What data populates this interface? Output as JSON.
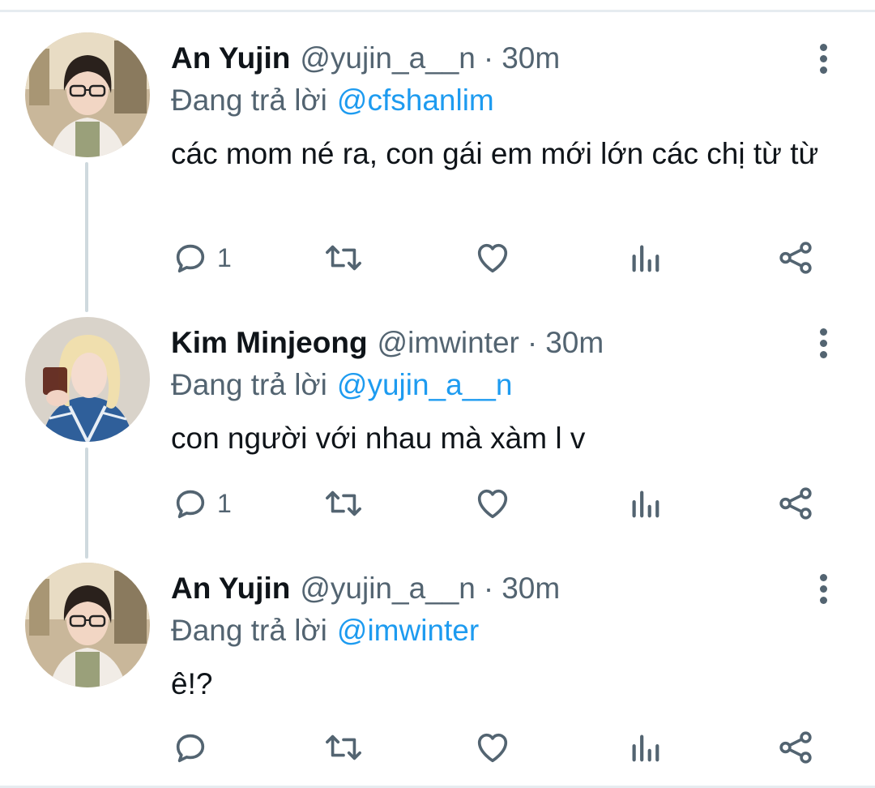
{
  "tweets": [
    {
      "name": "An Yujin",
      "handle": "@yujin_a__n",
      "separator": "·",
      "time": "30m",
      "reply_prefix": "Đang trả lời",
      "reply_to": "@cfshanlim",
      "text": "các mom né ra, con gái em mới lớn các chị từ từ",
      "reply_count": "1",
      "avatar_icon": "avatar-an-yujin"
    },
    {
      "name": "Kim Minjeong",
      "handle": "@imwinter",
      "separator": "·",
      "time": "30m",
      "reply_prefix": "Đang trả lời",
      "reply_to": "@yujin_a__n",
      "text": "con người với nhau mà xàm l v",
      "reply_count": "1",
      "avatar_icon": "avatar-kim-minjeong"
    },
    {
      "name": "An Yujin",
      "handle": "@yujin_a__n",
      "separator": "·",
      "time": "30m",
      "reply_prefix": "Đang trả lời",
      "reply_to": "@imwinter",
      "text": "ê!?",
      "reply_count": "",
      "avatar_icon": "avatar-an-yujin"
    }
  ],
  "icons": [
    "reply-icon",
    "retweet-icon",
    "like-icon",
    "views-icon",
    "share-icon",
    "more-options-icon"
  ],
  "colors": {
    "mention": "#1d9bf0",
    "secondary_text": "#536471",
    "primary_text": "#0f1419",
    "thread_line": "#cfd9de"
  }
}
